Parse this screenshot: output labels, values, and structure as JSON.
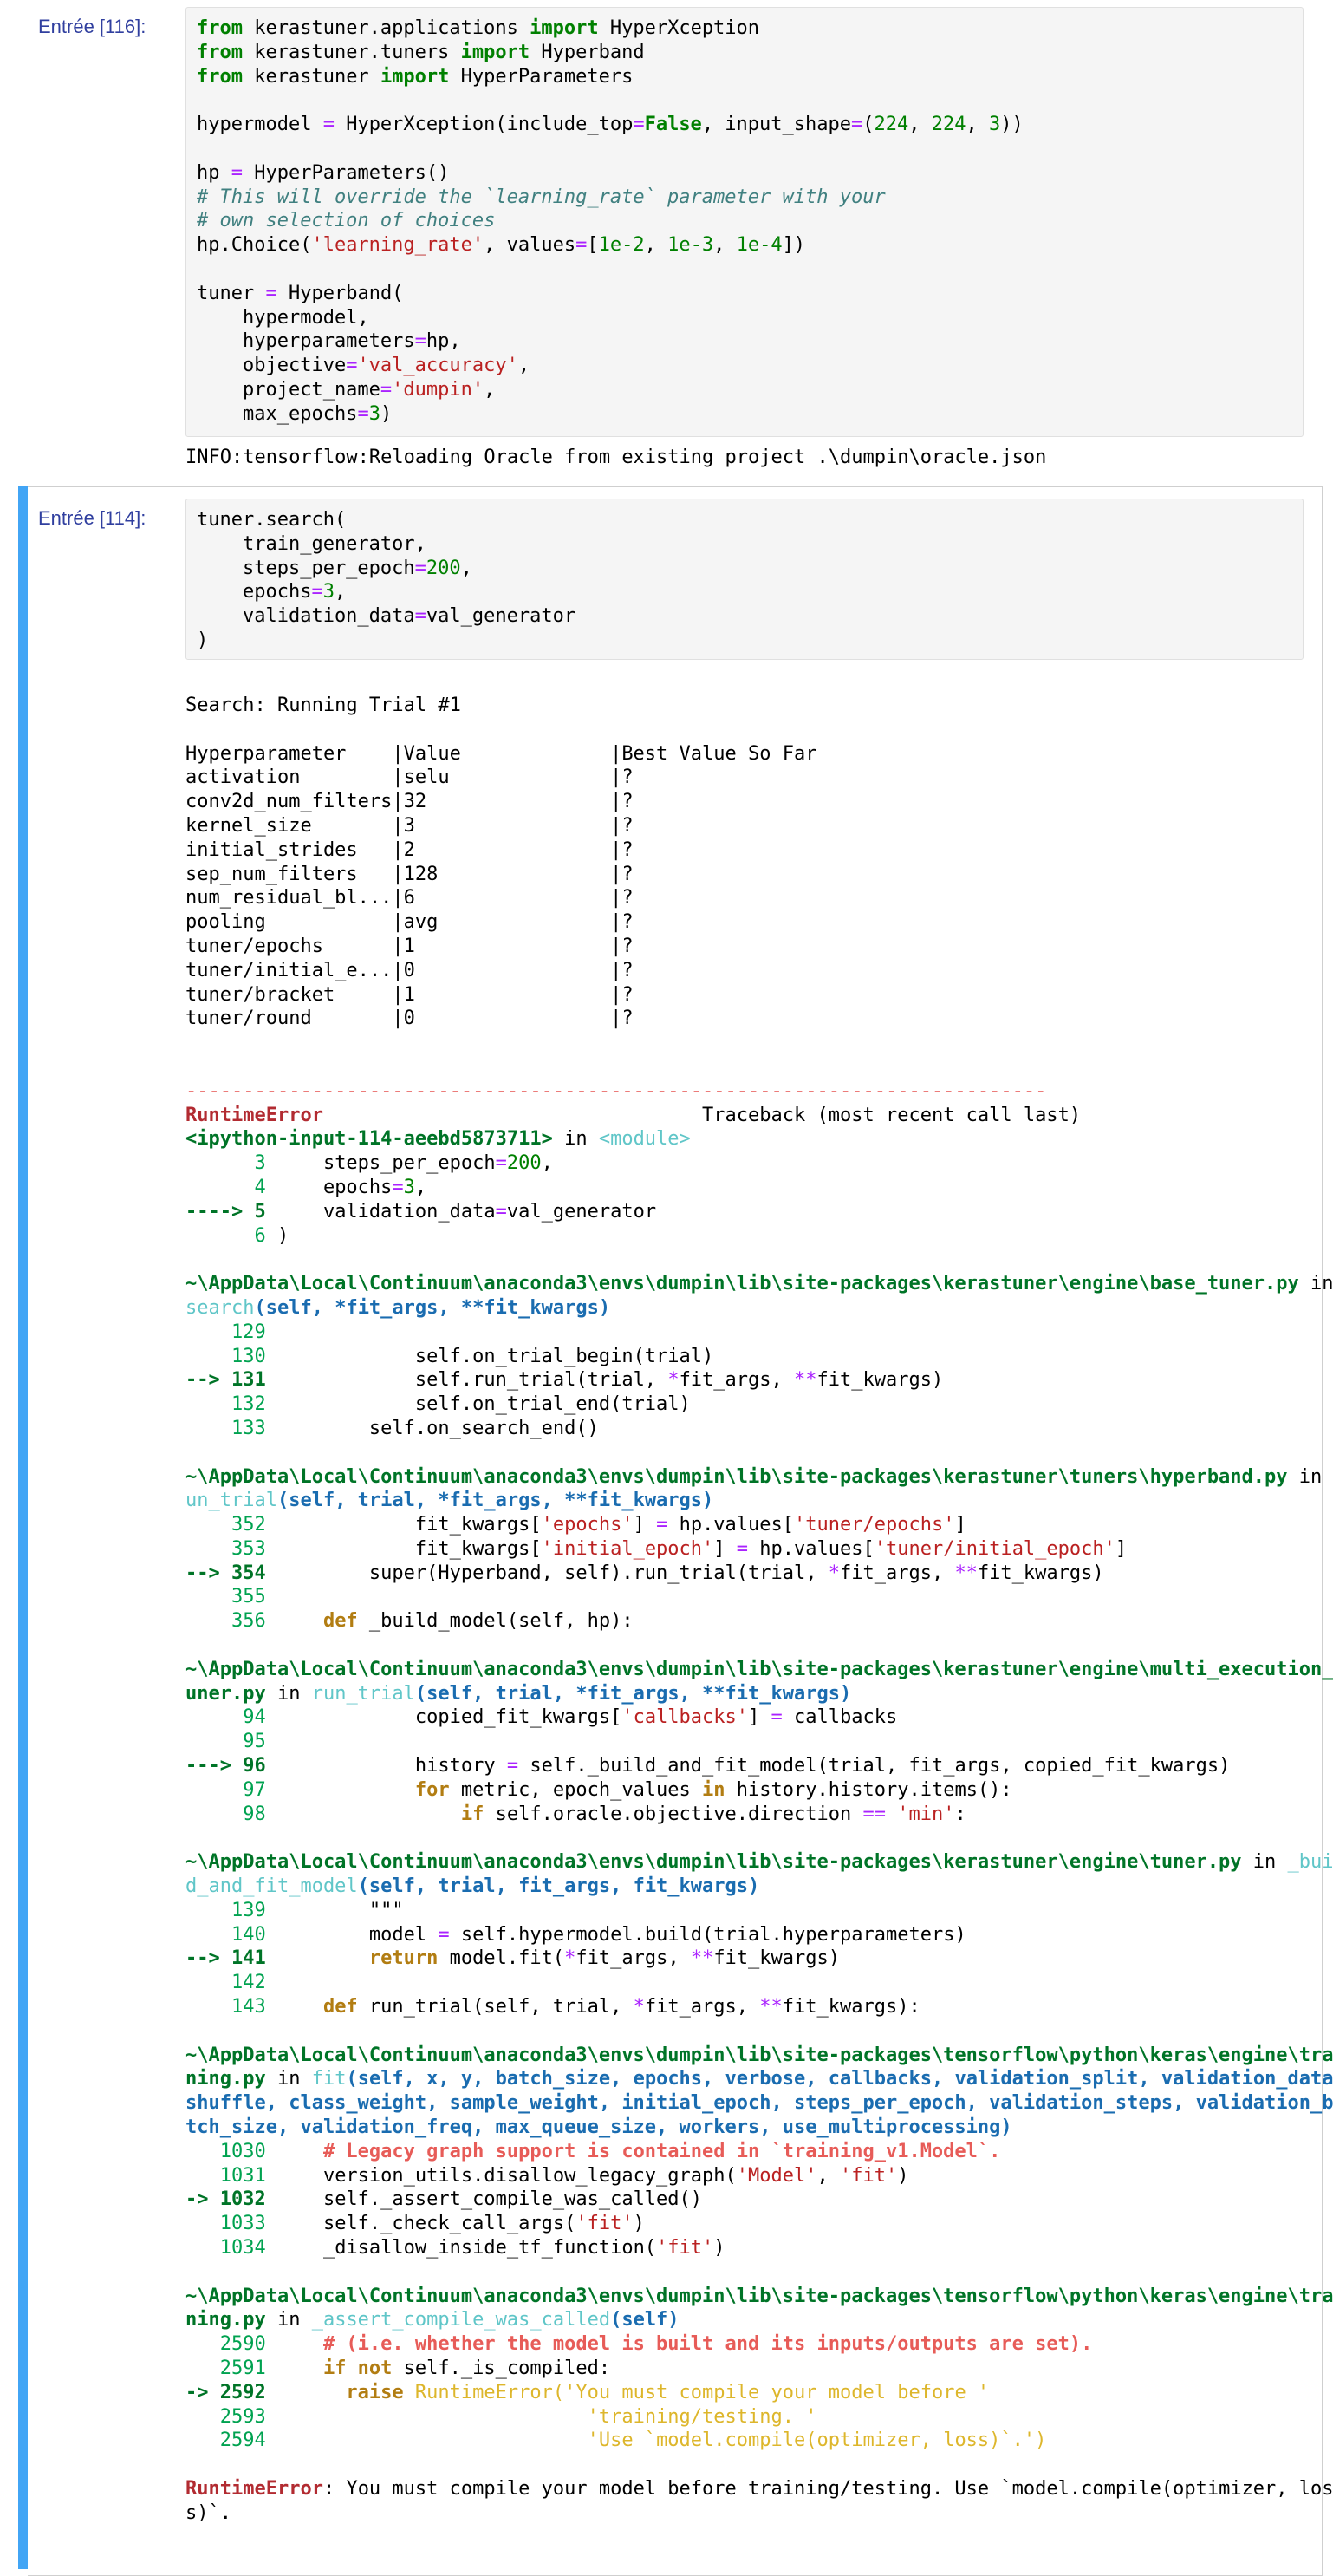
{
  "cell1": {
    "prompt": "Entrée [116]:",
    "code": {
      "l1_from": "from",
      "l1_mod": " kerastuner.applications ",
      "l1_import": "import",
      "l1_name": " HyperXception",
      "l2_from": "from",
      "l2_mod": " kerastuner.tuners ",
      "l2_import": "import",
      "l2_name": " Hyperband",
      "l3_from": "from",
      "l3_mod": " kerastuner ",
      "l3_import": "import",
      "l3_name": " HyperParameters",
      "l5_a": "hypermodel ",
      "l5_eq": "=",
      "l5_b": " HyperXception(include_top",
      "l5_eq2": "=",
      "l5_false": "False",
      "l5_c": ", input_shape",
      "l5_eq3": "=",
      "l5_d": "(",
      "l5_n1": "224",
      "l5_e": ", ",
      "l5_n2": "224",
      "l5_f": ", ",
      "l5_n3": "3",
      "l5_g": "))",
      "l7_a": "hp ",
      "l7_eq": "=",
      "l7_b": " HyperParameters()",
      "l8": "# This will override the `learning_rate` parameter with your",
      "l9": "# own selection of choices",
      "l10_a": "hp.Choice(",
      "l10_s": "'learning_rate'",
      "l10_b": ", values",
      "l10_eq": "=",
      "l10_c": "[",
      "l10_n1": "1e-2",
      "l10_d": ", ",
      "l10_n2": "1e-3",
      "l10_e": ", ",
      "l10_n3": "1e-4",
      "l10_f": "])",
      "l12_a": "tuner ",
      "l12_eq": "=",
      "l12_b": " Hyperband(",
      "l13": "    hypermodel,",
      "l14_a": "    hyperparameters",
      "l14_eq": "=",
      "l14_b": "hp,",
      "l15_a": "    objective",
      "l15_eq": "=",
      "l15_s": "'val_accuracy'",
      "l15_b": ",",
      "l16_a": "    project_name",
      "l16_eq": "=",
      "l16_s": "'dumpin'",
      "l16_b": ",",
      "l17_a": "    max_epochs",
      "l17_eq": "=",
      "l17_n": "3",
      "l17_b": ")"
    },
    "output": "INFO:tensorflow:Reloading Oracle from existing project .\\dumpin\\oracle.json"
  },
  "cell2": {
    "prompt": "Entrée [114]:",
    "code": {
      "l1": "tuner.search(",
      "l2": "    train_generator,",
      "l3_a": "    steps_per_epoch",
      "l3_eq": "=",
      "l3_n": "200",
      "l3_b": ",",
      "l4_a": "    epochs",
      "l4_eq": "=",
      "l4_n": "3",
      "l4_b": ",",
      "l5_a": "    validation_data",
      "l5_eq": "=",
      "l5_b": "val_generator",
      "l6": ")"
    },
    "search_header": "Search: Running Trial #1",
    "table_header": "Hyperparameter    |Value             |Best Value So Far",
    "table_rows": [
      "activation        |selu              |?",
      "conv2d_num_filters|32                |?",
      "kernel_size       |3                 |?",
      "initial_strides   |2                 |?",
      "sep_num_filters   |128               |?",
      "num_residual_bl...|6                 |?",
      "pooling           |avg               |?",
      "tuner/epochs      |1                 |?",
      "tuner/initial_e...|0                 |?",
      "tuner/bracket     |1                 |?",
      "tuner/round       |0                 |?"
    ],
    "tb": {
      "dashes": "---------------------------------------------------------------------------",
      "err_name": "RuntimeError",
      "tb_title": "                                 Traceback (most recent call last)",
      "f1_file": "<ipython-input-114-aeebd5873711>",
      "f1_in": " in ",
      "f1_func": "<module>",
      "f1_l3_no": "      3",
      "f1_l3_a": "     steps_per_epoch",
      "f1_l3_eq": "=",
      "f1_l3_n": "200",
      "f1_l3_b": ",",
      "f1_l4_no": "      4",
      "f1_l4_a": "     epochs",
      "f1_l4_eq": "=",
      "f1_l4_n": "3",
      "f1_l4_b": ",",
      "f1_l5_no": "----> 5",
      "f1_l5_a": "     validation_data",
      "f1_l5_eq": "=",
      "f1_l5_b": "val_generator",
      "f1_l6_no": "      6",
      "f1_l6_a": " )",
      "f2_path": "~\\AppData\\Local\\Continuum\\anaconda3\\envs\\dumpin\\lib\\site-packages\\kerastuner\\engine\\base_tuner.py",
      "f2_in": " in",
      "f2_func": "search",
      "f2_sig": "(self, *fit_args, **fit_kwargs)",
      "f2_l129": "    129",
      "f2_l130_no": "    130",
      "f2_l130": "             self.on_trial_begin(trial)",
      "f2_l131_no": "--> 131",
      "f2_l131_a": "             self.run_trial(trial, ",
      "f2_l131_op1": "*",
      "f2_l131_b": "fit_args, ",
      "f2_l131_op2": "**",
      "f2_l131_c": "fit_kwargs)",
      "f2_l132_no": "    132",
      "f2_l132": "             self.on_trial_end(trial)",
      "f2_l133_no": "    133",
      "f2_l133": "         self.on_search_end()",
      "f3_path": "~\\AppData\\Local\\Continuum\\anaconda3\\envs\\dumpin\\lib\\site-packages\\kerastuner\\tuners\\hyperband.py",
      "f3_in": " in ",
      "f3_func_a": "r",
      "f3_func_b": "un_trial",
      "f3_sig": "(self, trial, *fit_args, **fit_kwargs)",
      "f3_l352_no": "    352",
      "f3_l352_a": "             fit_kwargs[",
      "f3_l352_s1": "'epochs'",
      "f3_l352_b": "] ",
      "f3_l352_eq": "=",
      "f3_l352_c": " hp.values[",
      "f3_l352_s2": "'tuner/epochs'",
      "f3_l352_d": "]",
      "f3_l353_no": "    353",
      "f3_l353_a": "             fit_kwargs[",
      "f3_l353_s1": "'initial_epoch'",
      "f3_l353_b": "] ",
      "f3_l353_eq": "=",
      "f3_l353_c": " hp.values[",
      "f3_l353_s2": "'tuner/initial_epoch'",
      "f3_l353_d": "]",
      "f3_l354_no": "--> 354",
      "f3_l354_a": "         super(Hyperband, self).run_trial(trial, ",
      "f3_l354_op1": "*",
      "f3_l354_b": "fit_args, ",
      "f3_l354_op2": "**",
      "f3_l354_c": "fit_kwargs)",
      "f3_l355_no": "    355",
      "f3_l356_no": "    356",
      "f3_l356_kw": "     def",
      "f3_l356_a": " _build_model(self, hp):",
      "f4_path_a": "~\\AppData\\Local\\Continuum\\anaconda3\\envs\\dumpin\\lib\\site-packages\\kerastuner\\engine\\multi_execution_t",
      "f4_path_b": "uner.py",
      "f4_in": " in ",
      "f4_func": "run_trial",
      "f4_sig": "(self, trial, *fit_args, **fit_kwargs)",
      "f4_l94_no": "     94",
      "f4_l94_a": "             copied_fit_kwargs[",
      "f4_l94_s": "'callbacks'",
      "f4_l94_b": "] ",
      "f4_l94_eq": "=",
      "f4_l94_c": " callbacks",
      "f4_l95_no": "     95",
      "f4_l96_no": "---> 96",
      "f4_l96_a": "             history ",
      "f4_l96_eq": "=",
      "f4_l96_b": " self._build_and_fit_model(trial, fit_args, copied_fit_kwargs)",
      "f4_l97_no": "     97",
      "f4_l97_kw": "             for",
      "f4_l97_a": " metric, epoch_values ",
      "f4_l97_in": "in",
      "f4_l97_b": " history.history.items():",
      "f4_l98_no": "     98",
      "f4_l98_kw": "                 if",
      "f4_l98_a": " self.oracle.objective.direction ",
      "f4_l98_eq": "==",
      "f4_l98_b": " ",
      "f4_l98_s": "'min'",
      "f4_l98_c": ":",
      "f5_path": "~\\AppData\\Local\\Continuum\\anaconda3\\envs\\dumpin\\lib\\site-packages\\kerastuner\\engine\\tuner.py",
      "f5_in": " in ",
      "f5_func_a": "_buil",
      "f5_func_b": "d_and_fit_model",
      "f5_sig": "(self, trial, fit_args, fit_kwargs)",
      "f5_l139_no": "    139",
      "f5_l139": "         \"\"\"",
      "f5_l140_no": "    140",
      "f5_l140_a": "         model ",
      "f5_l140_eq": "=",
      "f5_l140_b": " self.hypermodel.build(trial.hyperparameters)",
      "f5_l141_no": "--> 141",
      "f5_l141_kw": "         return",
      "f5_l141_a": " model.fit(",
      "f5_l141_op1": "*",
      "f5_l141_b": "fit_args, ",
      "f5_l141_op2": "**",
      "f5_l141_c": "fit_kwargs)",
      "f5_l142_no": "    142",
      "f5_l143_no": "    143",
      "f5_l143_kw": "     def",
      "f5_l143_a": " run_trial(self, trial, ",
      "f5_l143_op1": "*",
      "f5_l143_b": "fit_args, ",
      "f5_l143_op2": "**",
      "f5_l143_c": "fit_kwargs):",
      "f6_path_a": "~\\AppData\\Local\\Continuum\\anaconda3\\envs\\dumpin\\lib\\site-packages\\tensorflow\\python\\keras\\engine\\trai",
      "f6_path_b": "ning.py",
      "f6_in": " in ",
      "f6_func": "fit",
      "f6_sig1": "(self, x, y, batch_size, epochs, verbose, callbacks, validation_split, validation_data,",
      "f6_sig2": "shuffle, class_weight, sample_weight, initial_epoch, steps_per_epoch, validation_steps, validation_ba",
      "f6_sig3": "tch_size, validation_freq, max_queue_size, workers, use_multiprocessing)",
      "f6_l1030_no": "   1030",
      "f6_l1030": "     # Legacy graph support is contained in `training_v1.Model`.",
      "f6_l1031_no": "   1031",
      "f6_l1031_a": "     version_utils.disallow_legacy_graph(",
      "f6_l1031_s1": "'Model'",
      "f6_l1031_b": ", ",
      "f6_l1031_s2": "'fit'",
      "f6_l1031_c": ")",
      "f6_l1032_no": "-> 1032",
      "f6_l1032": "     self._assert_compile_was_called()",
      "f6_l1033_no": "   1033",
      "f6_l1033_a": "     self._check_call_args(",
      "f6_l1033_s": "'fit'",
      "f6_l1033_b": ")",
      "f6_l1034_no": "   1034",
      "f6_l1034_a": "     _disallow_inside_tf_function(",
      "f6_l1034_s": "'fit'",
      "f6_l1034_b": ")",
      "f7_path_a": "~\\AppData\\Local\\Continuum\\anaconda3\\envs\\dumpin\\lib\\site-packages\\tensorflow\\python\\keras\\engine\\trai",
      "f7_path_b": "ning.py",
      "f7_in": " in ",
      "f7_func": "_assert_compile_was_called",
      "f7_sig": "(self)",
      "f7_l2590_no": "   2590",
      "f7_l2590": "     # (i.e. whether the model is built and its inputs/outputs are set).",
      "f7_l2591_no": "   2591",
      "f7_l2591_kw": "     if",
      "f7_l2591_not": " not",
      "f7_l2591_a": " self._is_compiled:",
      "f7_l2592_no": "-> 2592",
      "f7_l2592_kw": "       raise",
      "f7_l2592_a": " RuntimeError(",
      "f7_l2592_s": "'You must compile your model before '",
      "f7_l2593_no": "   2593",
      "f7_l2593_pad": "                            ",
      "f7_l2593_s": "'training/testing. '",
      "f7_l2594_no": "   2594",
      "f7_l2594_pad": "                            ",
      "f7_l2594_s": "'Use `model.compile(optimizer, loss)`.'",
      "f7_l2594_b": ")",
      "final_name": "RuntimeError",
      "final_msg": ": You must compile your model before training/testing. Use `model.compile(optimizer, los",
      "final_msg2": "s)`."
    }
  }
}
